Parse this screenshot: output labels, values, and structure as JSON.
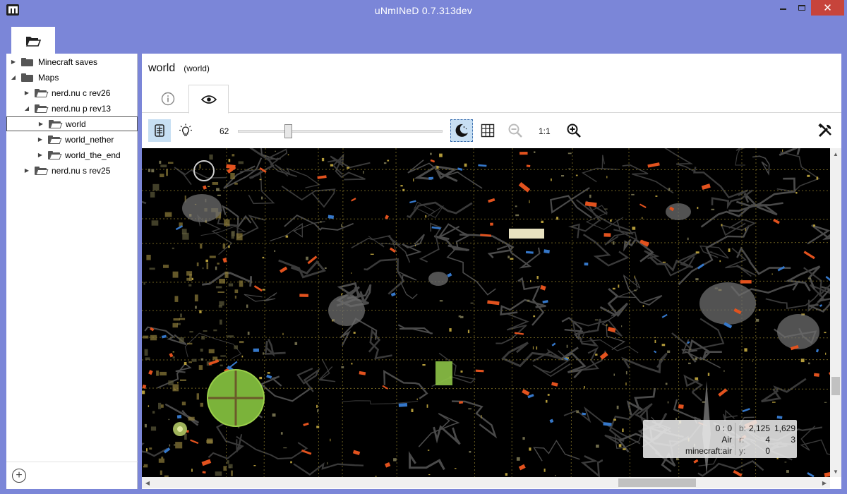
{
  "window": {
    "title": "uNmINeD 0.7.313dev",
    "close_glyph": "✕"
  },
  "tree": {
    "items": [
      {
        "label": "Minecraft saves",
        "depth": 0,
        "expanded": false,
        "open_folder": false
      },
      {
        "label": "Maps",
        "depth": 0,
        "expanded": true,
        "open_folder": false
      },
      {
        "label": "nerd.nu c rev26",
        "depth": 1,
        "expanded": false,
        "open_folder": true
      },
      {
        "label": "nerd.nu p rev13",
        "depth": 1,
        "expanded": true,
        "open_folder": true
      },
      {
        "label": "world",
        "depth": 2,
        "expanded": false,
        "open_folder": true,
        "selected": true
      },
      {
        "label": "world_nether",
        "depth": 2,
        "expanded": false,
        "open_folder": true
      },
      {
        "label": "world_the_end",
        "depth": 2,
        "expanded": false,
        "open_folder": true
      },
      {
        "label": "nerd.nu s rev25",
        "depth": 1,
        "expanded": false,
        "open_folder": true
      }
    ],
    "add_glyph": "+"
  },
  "world": {
    "title": "world",
    "subtitle": "(world)"
  },
  "toolbar": {
    "level": "62",
    "level_fraction": 0.24,
    "zoom_label": "1:1"
  },
  "overlay": {
    "left_lines": [
      "0 : 0",
      "Air",
      "minecraft:air"
    ],
    "keys": [
      "b:",
      "r:",
      "y:"
    ],
    "col1": [
      "2,125",
      "4",
      "0"
    ],
    "col2": [
      "1,629",
      "3",
      ""
    ]
  },
  "colors": {
    "titlebar": "#7b86d8",
    "close": "#c7443b",
    "active_button": "#c7dff3",
    "map_bg": "#000000"
  }
}
